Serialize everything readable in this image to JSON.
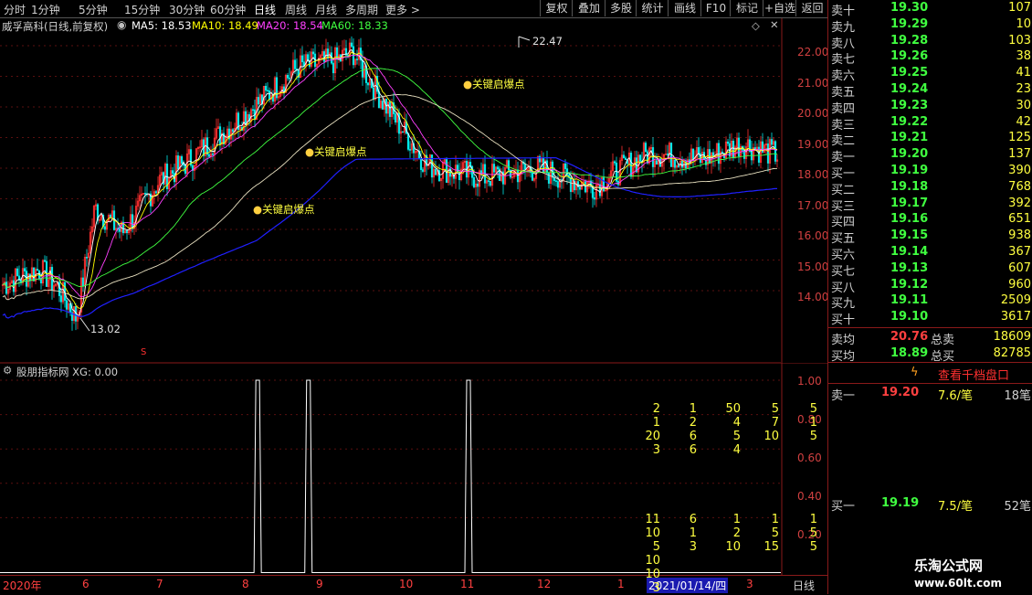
{
  "toolbar": {
    "periods": [
      "分时",
      "1分钟",
      "5分钟",
      "15分钟",
      "30分钟",
      "60分钟",
      "日线",
      "周线",
      "月线",
      "多周期",
      "更多 >"
    ],
    "active_period": "日线",
    "actions": [
      "复权",
      "叠加",
      "多股",
      "统计",
      "画线",
      "F10",
      "标记",
      "+自选",
      "返回"
    ]
  },
  "stock": {
    "title": "威孚高科(日线,前复权)",
    "ma5": "MA5: 18.53",
    "ma10": "MA10: 18.49",
    "ma20": "MA20: 18.54",
    "ma60": "MA60: 18.33",
    "high_label": "22.47",
    "low_label": "13.02",
    "signal_label": "关键启爆点",
    "s_marker": "S",
    "colors": {
      "ma5": "#ffffff",
      "ma10": "#ffff00",
      "ma20": "#ff40ff",
      "ma60": "#20ff20",
      "up": "#ff3030",
      "down": "#00ffff"
    }
  },
  "price_axis": [
    "22.00",
    "21.00",
    "20.00",
    "19.00",
    "18.00",
    "17.00",
    "16.00",
    "15.00",
    "14.00"
  ],
  "indicator": {
    "title": "股朋指标网 XG: 0.00",
    "axis": [
      "1.00",
      "0.80",
      "0.60",
      "0.40",
      "0.20"
    ],
    "spikes_at": [
      0.33,
      0.395,
      0.6
    ]
  },
  "date_axis": {
    "labels": [
      "2020年",
      "6",
      "7",
      "8",
      "9",
      "10",
      "11",
      "12",
      "1",
      "2021/01/14/四",
      "3"
    ],
    "period": "日线"
  },
  "order_book": {
    "sell": [
      {
        "name": "卖十",
        "price": "19.30",
        "vol": "107"
      },
      {
        "name": "卖九",
        "price": "19.29",
        "vol": "10"
      },
      {
        "name": "卖八",
        "price": "19.28",
        "vol": "103"
      },
      {
        "name": "卖七",
        "price": "19.26",
        "vol": "38"
      },
      {
        "name": "卖六",
        "price": "19.25",
        "vol": "41"
      },
      {
        "name": "卖五",
        "price": "19.24",
        "vol": "23"
      },
      {
        "name": "卖四",
        "price": "19.23",
        "vol": "30"
      },
      {
        "name": "卖三",
        "price": "19.22",
        "vol": "42"
      },
      {
        "name": "卖二",
        "price": "19.21",
        "vol": "125"
      },
      {
        "name": "卖一",
        "price": "19.20",
        "vol": "137"
      }
    ],
    "buy": [
      {
        "name": "买一",
        "price": "19.19",
        "vol": "390"
      },
      {
        "name": "买二",
        "price": "19.18",
        "vol": "768"
      },
      {
        "name": "买三",
        "price": "19.17",
        "vol": "392"
      },
      {
        "name": "买四",
        "price": "19.16",
        "vol": "651"
      },
      {
        "name": "买五",
        "price": "19.15",
        "vol": "938"
      },
      {
        "name": "买六",
        "price": "19.14",
        "vol": "367"
      },
      {
        "name": "买七",
        "price": "19.13",
        "vol": "607"
      },
      {
        "name": "买八",
        "price": "19.12",
        "vol": "960"
      },
      {
        "name": "买九",
        "price": "19.11",
        "vol": "2509"
      },
      {
        "name": "买十",
        "price": "19.10",
        "vol": "3617"
      }
    ],
    "sell_avg_label": "卖均",
    "sell_avg": "20.76",
    "total_sell_label": "总卖",
    "total_sell": "18609",
    "buy_avg_label": "买均",
    "buy_avg": "18.89",
    "total_buy_label": "总买",
    "total_buy": "82785",
    "view_button": "查看千档盘口"
  },
  "sell_detail": {
    "name": "卖一",
    "price": "19.20",
    "avg": "7.6/笔",
    "count": "18笔",
    "rows": [
      [
        "2",
        "1",
        "50",
        "5",
        "5"
      ],
      [
        "1",
        "2",
        "4",
        "7",
        "1"
      ],
      [
        "20",
        "6",
        "5",
        "10",
        "5"
      ],
      [
        "3",
        "6",
        "4",
        "",
        ""
      ]
    ]
  },
  "buy_detail": {
    "name": "买一",
    "price": "19.19",
    "avg": "7.5/笔",
    "count": "52笔",
    "rows": [
      [
        "11",
        "6",
        "1",
        "1",
        "1"
      ],
      [
        "10",
        "1",
        "2",
        "5",
        "5"
      ],
      [
        "5",
        "3",
        "10",
        "15",
        "5"
      ],
      [
        "10",
        "",
        "",
        "",
        ""
      ],
      [
        "10",
        "",
        "",
        "",
        ""
      ],
      [
        "3",
        "",
        "",
        "",
        ""
      ]
    ]
  },
  "watermark": {
    "line1": "乐淘公式网",
    "line2": "www.60lt.com"
  }
}
